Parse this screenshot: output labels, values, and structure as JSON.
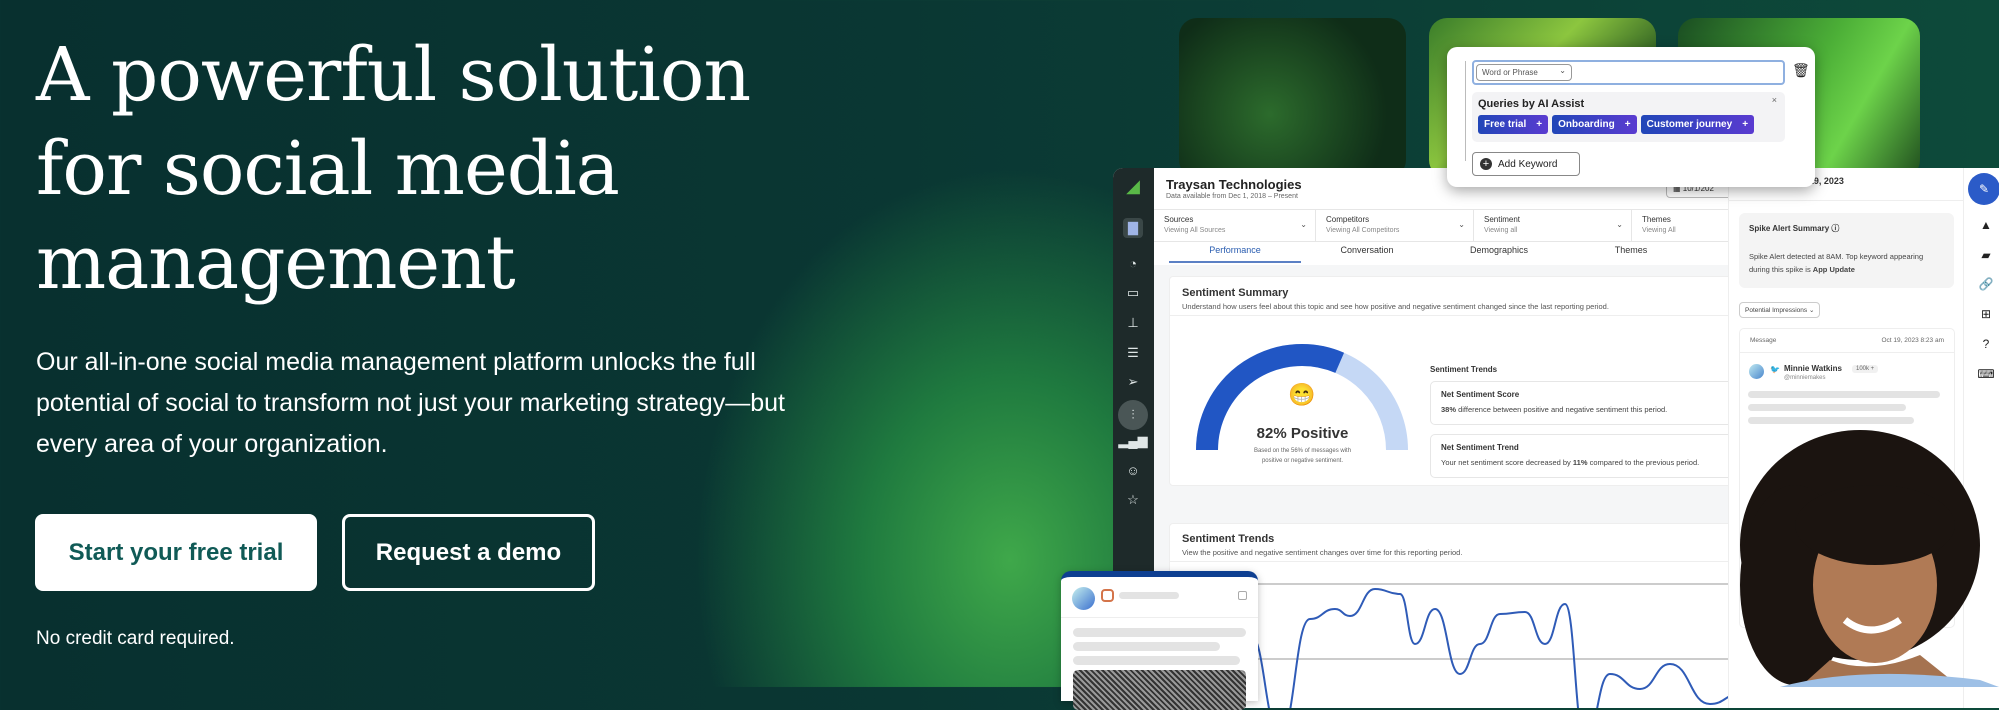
{
  "hero": {
    "headline": [
      "A powerful solution",
      "for social media",
      "management"
    ],
    "lead": "Our all-in-one social media management platform unlocks the full potential of social to transform not just your marketing strategy—but every area of your organization.",
    "primary_cta": "Start your free trial",
    "secondary_cta": "Request a demo",
    "note": "No credit card required."
  },
  "query_popup": {
    "select_value": "Word or Phrase",
    "ai_title": "Queries by AI Assist",
    "chips": [
      "Free trial",
      "Onboarding",
      "Customer journey"
    ],
    "add_keyword": "Add Keyword"
  },
  "dashboard": {
    "company": "Traysan Technologies",
    "company_sub": "Data available from Dec 1, 2018 – Present",
    "date_partial": "10/1/202",
    "filters": [
      {
        "label": "Sources",
        "value": "Viewing All Sources"
      },
      {
        "label": "Competitors",
        "value": "Viewing All Competitors"
      },
      {
        "label": "Sentiment",
        "value": "Viewing all"
      },
      {
        "label": "Themes",
        "value": "Viewing All"
      }
    ],
    "tabs": [
      "Performance",
      "Conversation",
      "Demographics",
      "Themes"
    ],
    "active_tab": "Performance",
    "summary": {
      "title": "Sentiment Summary",
      "subtitle": "Understand how users feel about this topic and see how positive and negative sentiment changed since the last reporting period.",
      "gauge_label": "82% Positive",
      "gauge_note_1": "Based on the 56% of messages with",
      "gauge_note_2": "positive or negative sentiment.",
      "trends_heading": "Sentiment Trends",
      "score_title": "Net Sentiment Score",
      "score_bold": "38%",
      "score_text": " difference between positive and negative sentiment this period.",
      "trend_title": "Net Sentiment Trend",
      "trend_text_1": "Your net sentiment score decreased by ",
      "trend_bold": "11%",
      "trend_text_2": " compared to the previous period."
    },
    "trends": {
      "title": "Sentiment Trends",
      "subtitle": "View the positive and negative sentiment changes over time for this reporting period.",
      "line_color": "#2f5bb7"
    },
    "right_panel": {
      "date": "Saturday, October 19, 2023",
      "spike_title": "Spike Alert Summary",
      "spike_text": "Spike Alert detected at 8AM. Top keyword appearing during this spike is ",
      "spike_bold": "App Update",
      "dropdown": "Potential Impressions",
      "msg_header": "Message",
      "msg_date": "Oct 19, 2023 8:23 am",
      "author": "Minnie Watkins",
      "handle": "@minniemakes",
      "followers": "100k +"
    }
  },
  "colors": {
    "brand_dark": "#08302f",
    "cta_text": "#105a56",
    "accent_blue": "#2a5db0",
    "gauge_light": "#c5d8f5"
  }
}
